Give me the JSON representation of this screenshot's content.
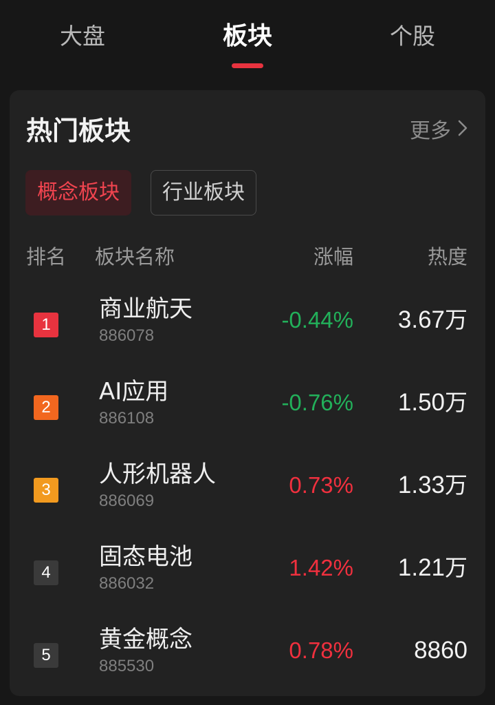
{
  "tabs": [
    {
      "label": "大盘",
      "active": false
    },
    {
      "label": "板块",
      "active": true
    },
    {
      "label": "个股",
      "active": false
    }
  ],
  "card": {
    "title": "热门板块",
    "more_label": "更多",
    "more_icon": "chevron-right-icon"
  },
  "filters": {
    "concept": "概念板块",
    "industry": "行业板块",
    "selected": "概念板块"
  },
  "table": {
    "headers": {
      "rank": "排名",
      "name": "板块名称",
      "change": "涨幅",
      "heat": "热度"
    },
    "rows": [
      {
        "rank": "1",
        "name": "商业航天",
        "code": "886078",
        "change": "-0.44%",
        "heat_value": "3.67",
        "heat_unit": "万",
        "direction": "down",
        "rank_color": "#e8333f"
      },
      {
        "rank": "2",
        "name": "AI应用",
        "code": "886108",
        "change": "-0.76%",
        "heat_value": "1.50",
        "heat_unit": "万",
        "direction": "down",
        "rank_color": "#f2671f"
      },
      {
        "rank": "3",
        "name": "人形机器人",
        "code": "886069",
        "change": "0.73%",
        "heat_value": "1.33",
        "heat_unit": "万",
        "direction": "up",
        "rank_color": "#f29a1f"
      },
      {
        "rank": "4",
        "name": "固态电池",
        "code": "886032",
        "change": "1.42%",
        "heat_value": "1.21",
        "heat_unit": "万",
        "direction": "up",
        "rank_color": "#3a3a3a"
      },
      {
        "rank": "5",
        "name": "黄金概念",
        "code": "885530",
        "change": "0.78%",
        "heat_value": "8860",
        "heat_unit": "",
        "direction": "up",
        "rank_color": "#3a3a3a"
      }
    ]
  },
  "colors": {
    "up": "#f0303e",
    "down": "#22b05a",
    "accent": "#e8333f"
  }
}
